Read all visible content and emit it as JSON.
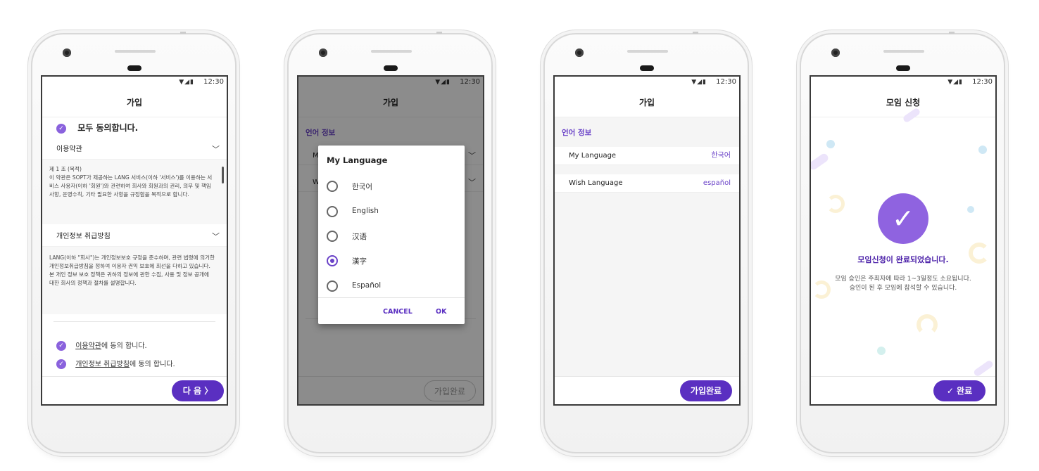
{
  "status": {
    "icons": "▼◢▮",
    "time": "12:30"
  },
  "screen1": {
    "title": "가입",
    "agree_all": "모두 동의합니다.",
    "terms_header": "이용약관",
    "terms_text": "제 1 조 (목적)\n이 약관은 SOPT가 제공하는 LANG 서비스(이하 '서비스')를 이용하는 서비스 사용자(이하 '회원')와 관련하여 회사와 회원과의 권리, 의무 및 책임사항, 운영수칙, 기타 필요한 사항을 규정함을 목적으로 합니다.",
    "privacy_header": "개인정보 취급방침",
    "privacy_text": "LANG(이하 \"회사\")는 개인정보보호 규정을 준수하며, 관련 법령에 의거한 개인정보취급방침을 정하여 이용자 권익 보호에 최선을 다하고 있습니다.\n본 개인 정보 보호 정책은 귀하의 정보에 관한 수집, 사용 및 정보 공개에 대한 회사의 정책과 절차를 설명합니다.",
    "agree_terms_link": "이용약관",
    "agree_terms_suffix": "에 동의 합니다.",
    "agree_privacy_link": "개인정보 취급방침",
    "agree_privacy_suffix": "에 동의 합니다.",
    "next_button": "다 음  〉"
  },
  "screen2": {
    "title": "가입",
    "section": "언어 정보",
    "row1_partial": "M",
    "row2_partial": "W",
    "dialog_title": "My Language",
    "options": [
      "한국어",
      "English",
      "汉语",
      "漢字",
      "Español"
    ],
    "selected_index": 3,
    "cancel": "CANCEL",
    "ok": "OK",
    "finish_button": "가입완료"
  },
  "screen3": {
    "title": "가입",
    "section": "언어 정보",
    "my_language_label": "My Language",
    "my_language_value": "한국어",
    "wish_language_label": "Wish Language",
    "wish_language_value": "español",
    "finish_button": "가입완료"
  },
  "screen4": {
    "title": "모임 신청",
    "done_message": "모임신청이 완료되었습니다.",
    "sub_line1": "모임 승인은 주최자에 따라 1~3일정도 소요됩니다.",
    "sub_line2": "승인이 된 후 모임에 참석할 수 있습니다.",
    "done_button": "✓  완료"
  },
  "colors": {
    "accent": "#5a2fc1",
    "accent_light": "#8f63e0"
  }
}
